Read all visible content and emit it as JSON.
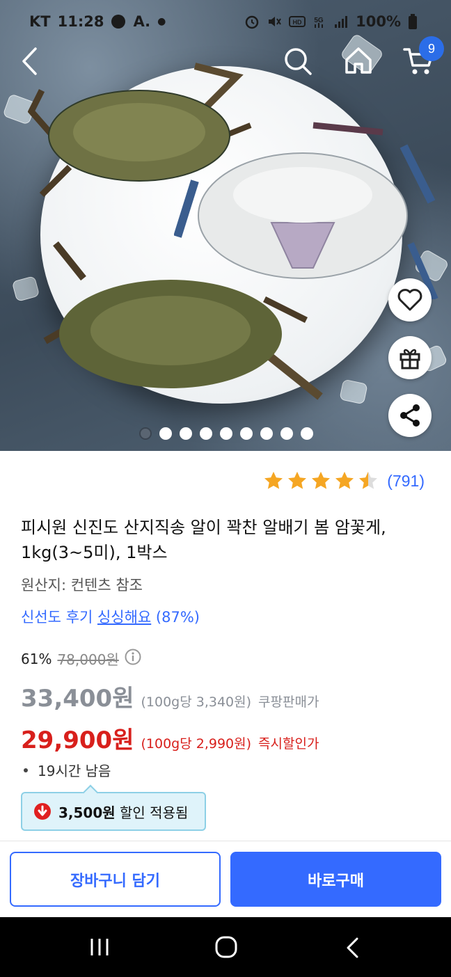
{
  "status_bar": {
    "carrier": "KT",
    "time": "11:28",
    "extra_label": "A.",
    "battery": "100%",
    "icons": [
      "alarm-icon",
      "mute-icon",
      "hd-icon",
      "5g-icon",
      "signal-icon",
      "battery-icon"
    ]
  },
  "header": {
    "cart_count": "9",
    "icons": [
      "back-arrow-icon",
      "search-icon",
      "home-icon",
      "cart-icon"
    ]
  },
  "gallery": {
    "image_count": 9,
    "active_index": 0,
    "side_actions": [
      "heart-icon",
      "gift-icon",
      "share-icon"
    ]
  },
  "product": {
    "rating": 4.5,
    "review_count": "(791)",
    "title_line1": "피시원 신진도 산지직송 알이 꽉찬 알배기 봄 암꽃게,",
    "title_line2": "1kg(3~5미), 1박스",
    "origin": "원산지: 컨텐츠 참조",
    "freshness_label": "신선도 후기 ",
    "freshness_value": "싱싱해요",
    "freshness_pct": " (87%)",
    "discount_rate": "61%",
    "original_price": "78,000원",
    "coupang_price": "33,400원",
    "coupang_unit": "(100g당 3,340원)",
    "coupang_tag": "쿠팡판매가",
    "instant_price": "29,900원",
    "instant_unit": "(100g당 2,990원)",
    "instant_tag": "즉시할인가",
    "time_left": "19시간 남음",
    "coupon_amount": "3,500원",
    "coupon_text": " 할인 적용됨"
  },
  "actions": {
    "add_to_cart": "장바구니 담기",
    "buy_now": "바로구매"
  },
  "colors": {
    "accent": "#346aff",
    "sale_red": "#d8201c",
    "coupon_bg": "#dff3fa",
    "star": "#f5a623"
  }
}
